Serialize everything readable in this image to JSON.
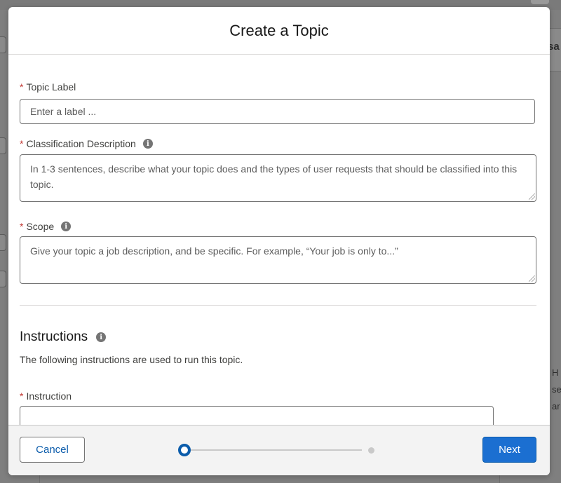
{
  "background": {
    "right_heading_fragment": "sa",
    "right_text_fragments": [
      "H",
      "se",
      "ar"
    ]
  },
  "modal": {
    "title": "Create a Topic",
    "fields": {
      "topic_label": {
        "label": "Topic Label",
        "required_marker": "*",
        "placeholder": "Enter a label ..."
      },
      "classification_description": {
        "label": "Classification Description",
        "required_marker": "*",
        "info_icon": "info-icon",
        "placeholder": "In 1-3 sentences, describe what your topic does and the types of user requests that should be classified into this topic."
      },
      "scope": {
        "label": "Scope",
        "required_marker": "*",
        "info_icon": "info-icon",
        "placeholder": "Give your topic a job description, and be specific. For example, “Your job is only to...”"
      }
    },
    "instructions": {
      "title": "Instructions",
      "info_icon": "info-icon",
      "description": "The following instructions are used to run this topic.",
      "instruction_field": {
        "label": "Instruction",
        "required_marker": "*"
      }
    },
    "footer": {
      "cancel_label": "Cancel",
      "next_label": "Next",
      "progress": {
        "current_step": 1,
        "total_steps": 2
      }
    }
  },
  "colors": {
    "primary": "#1b6fd1",
    "required": "#c23934",
    "link": "#0b5cab",
    "overlay": "#7f7f7f"
  }
}
